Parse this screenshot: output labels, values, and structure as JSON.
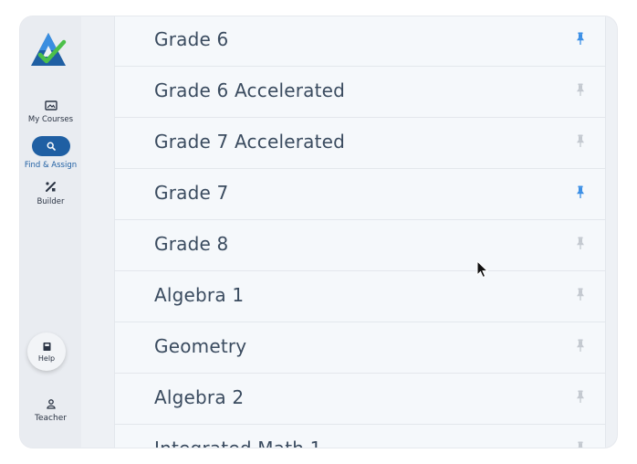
{
  "sidebar": {
    "items": [
      {
        "label": "My Courses",
        "icon": "image-icon"
      },
      {
        "label": "Find & Assign",
        "icon": "search-icon",
        "active": true
      },
      {
        "label": "Builder",
        "icon": "tools-icon"
      }
    ],
    "help": {
      "label": "Help",
      "icon": "book-icon"
    },
    "user": {
      "label": "Teacher",
      "icon": "person-icon"
    }
  },
  "courses": [
    {
      "name": "Grade 6",
      "pinned": true
    },
    {
      "name": "Grade 6 Accelerated",
      "pinned": false
    },
    {
      "name": "Grade 7 Accelerated",
      "pinned": false
    },
    {
      "name": "Grade 7",
      "pinned": true
    },
    {
      "name": "Grade 8",
      "pinned": false
    },
    {
      "name": "Algebra 1",
      "pinned": false
    },
    {
      "name": "Geometry",
      "pinned": false
    },
    {
      "name": "Algebra 2",
      "pinned": false
    },
    {
      "name": "Integrated Math 1",
      "pinned": false
    }
  ],
  "colors": {
    "accent": "#1f5fa3",
    "pin_active": "#3b8fe6",
    "pin_inactive": "#c4c9d0"
  }
}
